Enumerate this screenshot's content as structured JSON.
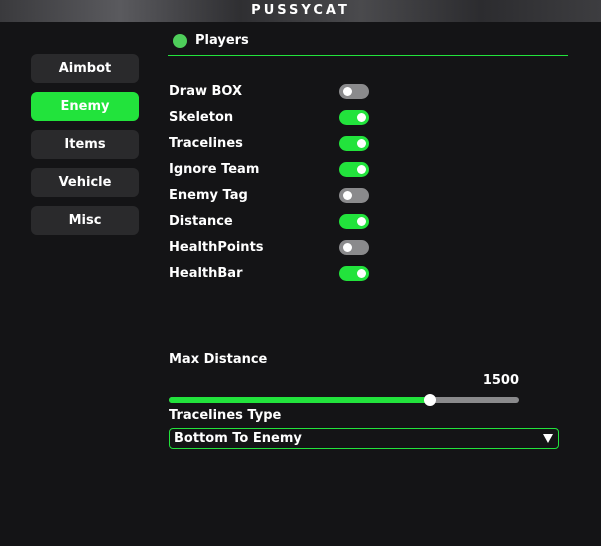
{
  "window": {
    "title": "PUSSYCAT"
  },
  "sidebar": {
    "items": [
      {
        "label": "Aimbot",
        "active": false
      },
      {
        "label": "Enemy",
        "active": true
      },
      {
        "label": "Items",
        "active": false
      },
      {
        "label": "Vehicle",
        "active": false
      },
      {
        "label": "Misc",
        "active": false
      }
    ]
  },
  "section": {
    "title": "Players",
    "icon": "green-dot-icon"
  },
  "options": [
    {
      "label": "Draw BOX",
      "enabled": false
    },
    {
      "label": "Skeleton",
      "enabled": true
    },
    {
      "label": "Tracelines",
      "enabled": true
    },
    {
      "label": "Ignore Team",
      "enabled": true
    },
    {
      "label": "Enemy Tag",
      "enabled": false
    },
    {
      "label": "Distance",
      "enabled": true
    },
    {
      "label": "HealthPoints",
      "enabled": false
    },
    {
      "label": "HealthBar",
      "enabled": true
    }
  ],
  "max_distance": {
    "label": "Max Distance",
    "value": "1500",
    "fraction": 0.745
  },
  "tracelines_type": {
    "label": "Tracelines Type",
    "selected": "Bottom To Enemy"
  },
  "colors": {
    "accent": "#22e33c",
    "background": "#141416",
    "button": "#2a2a2c",
    "toggle_off": "#8a8a8c"
  }
}
